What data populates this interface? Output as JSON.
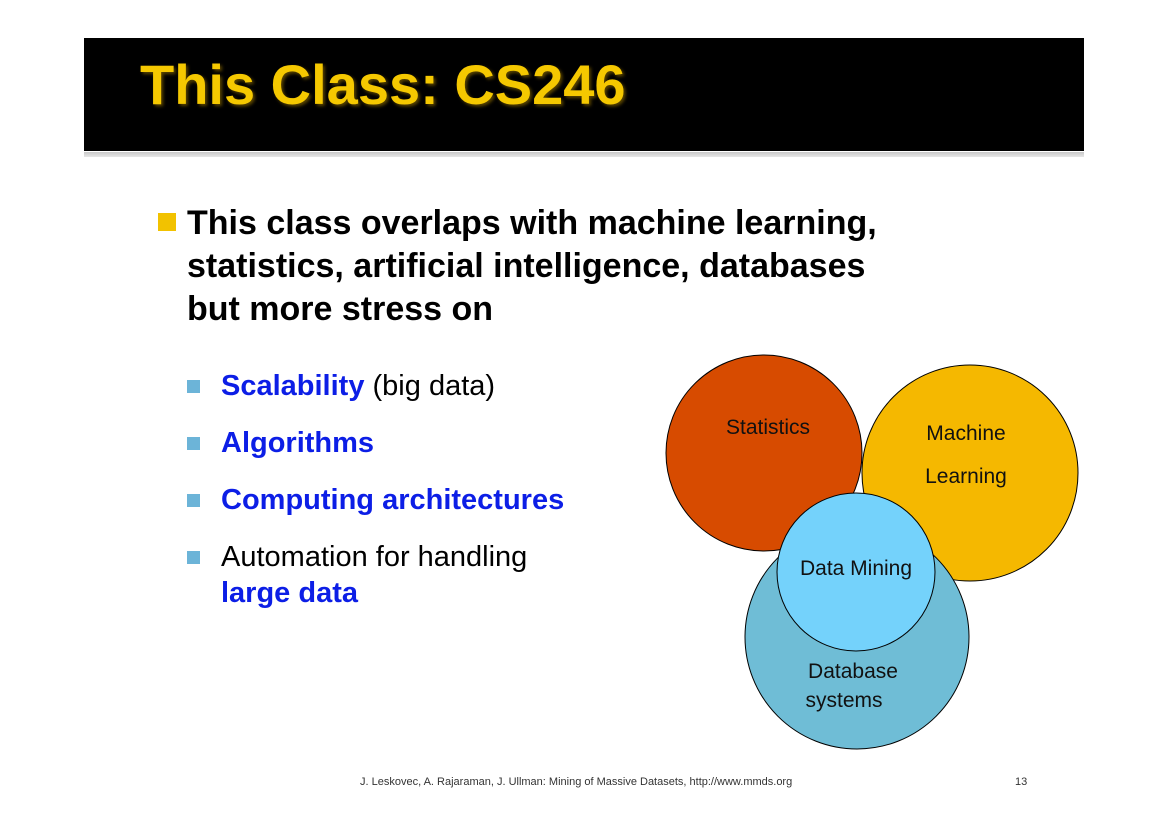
{
  "title": "This Class: CS246",
  "bullet": {
    "lines": [
      "This class overlaps with machine learning,",
      "statistics, artificial intelligence, databases",
      "but more stress on"
    ]
  },
  "sub_items": [
    {
      "highlight": "Scalability",
      "rest": " (big data)"
    },
    {
      "highlight": "Algorithms",
      "rest": ""
    },
    {
      "highlight": "Computing architectures",
      "rest": ""
    },
    {
      "plain": "Automation for handling",
      "highlight2": "large data"
    }
  ],
  "venn": {
    "statistics": "Statistics",
    "machine": "Machine",
    "learning": "Learning",
    "data_mining": "Data Mining",
    "database": "Database",
    "systems": "systems"
  },
  "colors": {
    "title_yellow": "#f5c800",
    "statistics": "#d74b00",
    "machine_learning": "#f5b800",
    "database": "#6fbdd6",
    "data_mining": "#74d2fb",
    "emphasis_blue": "#0c1ee6"
  },
  "footer": "J. Leskovec, A. Rajaraman, J. Ullman: Mining of Massive Datasets, http://www.mmds.org",
  "page_number": "13"
}
